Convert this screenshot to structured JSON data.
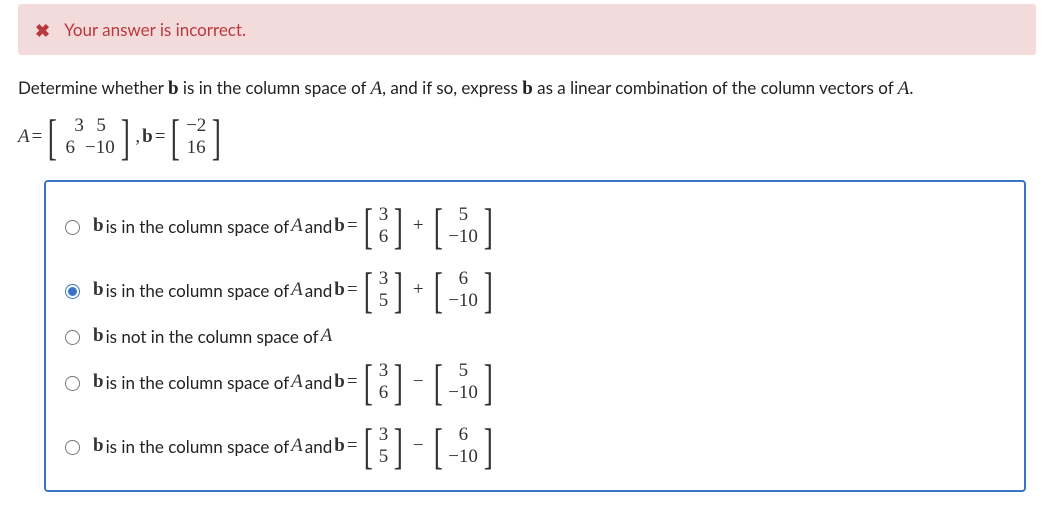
{
  "feedback": {
    "icon": "✖",
    "text": "Your answer is incorrect."
  },
  "prompt": {
    "pre": "Determine whether ",
    "b1": "b",
    "mid1": " is in the column space of ",
    "A1": "A",
    "mid2": ", and if so, express ",
    "b2": "b",
    "mid3": " as a linear combination of the column vectors of ",
    "A2": "A",
    "end": "."
  },
  "given": {
    "A_label": "A",
    "eq1": " = ",
    "A": [
      [
        "3",
        "5"
      ],
      [
        "6",
        "−10"
      ]
    ],
    "comma": ", ",
    "b_label": "b",
    "eq2": " = ",
    "b": [
      [
        "−2"
      ],
      [
        "16"
      ]
    ]
  },
  "options": [
    {
      "text_pre": "b",
      "text_mid1": " is in the column space of ",
      "text_A": "A",
      "text_mid2": " and ",
      "text_b": "b",
      "text_eq": " = ",
      "m1": [
        [
          "3"
        ],
        [
          "6"
        ]
      ],
      "op": "+",
      "m2": [
        [
          "5"
        ],
        [
          "−10"
        ]
      ],
      "selected": false,
      "short": false
    },
    {
      "text_pre": "b",
      "text_mid1": " is in the column space of ",
      "text_A": "A",
      "text_mid2": " and ",
      "text_b": "b",
      "text_eq": " = ",
      "m1": [
        [
          "3"
        ],
        [
          "5"
        ]
      ],
      "op": "+",
      "m2": [
        [
          "6"
        ],
        [
          "−10"
        ]
      ],
      "selected": true,
      "short": false
    },
    {
      "text_pre": "b",
      "text_mid1": " is not in the column space of ",
      "text_A": "A",
      "selected": false,
      "short": true
    },
    {
      "text_pre": "b",
      "text_mid1": " is in the column space of ",
      "text_A": "A",
      "text_mid2": " and ",
      "text_b": "b",
      "text_eq": " = ",
      "m1": [
        [
          "3"
        ],
        [
          "6"
        ]
      ],
      "op": "−",
      "m2": [
        [
          "5"
        ],
        [
          "−10"
        ]
      ],
      "selected": false,
      "short": false
    },
    {
      "text_pre": "b",
      "text_mid1": " is in the column space of ",
      "text_A": "A",
      "text_mid2": " and ",
      "text_b": "b",
      "text_eq": " = ",
      "m1": [
        [
          "3"
        ],
        [
          "5"
        ]
      ],
      "op": "−",
      "m2": [
        [
          "6"
        ],
        [
          "−10"
        ]
      ],
      "selected": false,
      "short": false
    }
  ]
}
